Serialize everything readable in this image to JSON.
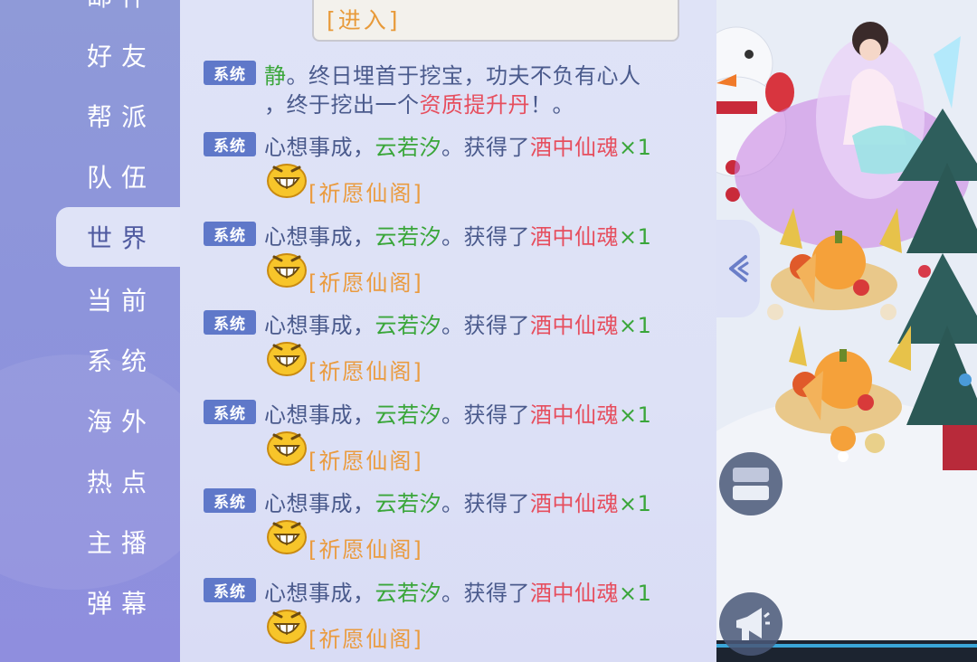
{
  "sidebar": {
    "tabs": [
      {
        "label": "邮件"
      },
      {
        "label": "好友"
      },
      {
        "label": "帮派"
      },
      {
        "label": "队伍"
      },
      {
        "label": "世界",
        "active": true
      },
      {
        "label": "当前"
      },
      {
        "label": "系统"
      },
      {
        "label": "海外"
      },
      {
        "label": "热点"
      },
      {
        "label": "主播"
      },
      {
        "label": "弹幕"
      }
    ]
  },
  "chat": {
    "notice": {
      "enter_label": "[进入]"
    },
    "badge_label": "系统",
    "first_message": {
      "name": "静",
      "text_a": "。终日埋首于挖宝，功夫不负有心人",
      "text_b": "，终于挖出一个",
      "item": "资质提升丹",
      "suffix": "！。"
    },
    "wish_message": {
      "prefix": "心想事成，",
      "name": "云若汐",
      "middle": "。获得了",
      "item": "酒中仙魂",
      "count": "×1",
      "link": "[祈愿仙阁]"
    }
  },
  "colors": {
    "badge": "#5f78c9",
    "name_green": "#3aa63a",
    "item_red": "#e64e5e",
    "link_orange": "#ea9b3f",
    "text": "#4a5a8c"
  },
  "icons": [
    "grin-emoji-icon",
    "collapse-arrow-icon",
    "window-toggle-icon",
    "megaphone-icon"
  ]
}
